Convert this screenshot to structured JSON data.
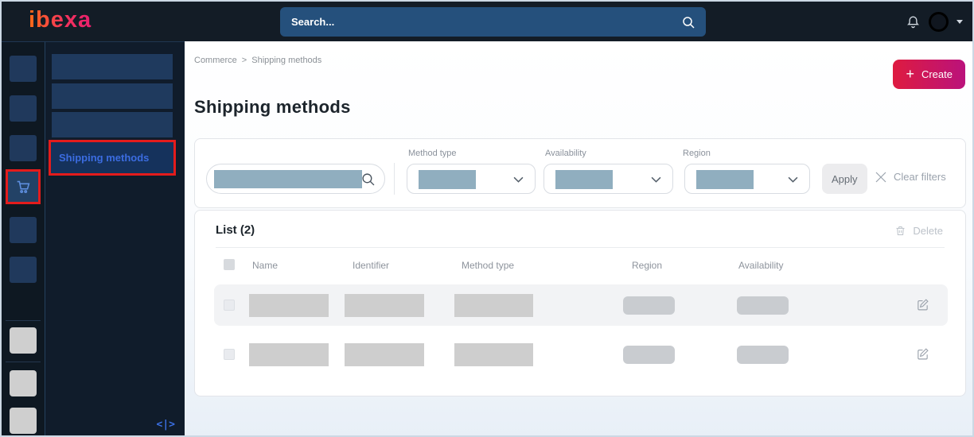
{
  "topbar": {
    "logo": "ibexa",
    "search_placeholder": "Search..."
  },
  "breadcrumb": {
    "items": [
      "Commerce",
      "Shipping methods"
    ],
    "separator": ">"
  },
  "page": {
    "title": "Shipping methods",
    "create": {
      "plus": "+",
      "label": "Create"
    }
  },
  "filters": {
    "method_type_label": "Method type",
    "availability_label": "Availability",
    "region_label": "Region",
    "apply_label": "Apply",
    "clear_filters_label": "Clear filters"
  },
  "list": {
    "title": "List (2)",
    "delete_label": "Delete",
    "columns": [
      "Name",
      "Identifier",
      "Method type",
      "Region",
      "Availability"
    ],
    "row_count": 2
  },
  "sidebar": {
    "active_item": "Shipping methods",
    "collapse_glyph": "<|>"
  },
  "icons": {
    "topbar_search": "search-icon",
    "notifications": "bell-icon",
    "user_menu": "caret-down-icon",
    "active_nav": "shopping-cart-icon",
    "filter_search": "search-icon",
    "dropdowns": "chevron-down-icon",
    "clear": "x-icon",
    "delete": "trash-icon",
    "row_edit": "edit-icon",
    "collapse": "panel-collapse-icon"
  },
  "colors": {
    "topbar_bg": "#131c26",
    "search_bar_bg": "#25507c",
    "rail_bg": "#0e1822",
    "nav_tile": "#20395c",
    "submenu_tile": "#1f3a5e",
    "annotation_red": "#e41c1c",
    "link_blue": "#3b6ce0",
    "create_gradient": [
      "#de1b40",
      "#ba127b"
    ],
    "placeholder_blue": "#90aebf",
    "placeholder_gray": "#cecece",
    "row_stripe": "#f2f3f5"
  }
}
